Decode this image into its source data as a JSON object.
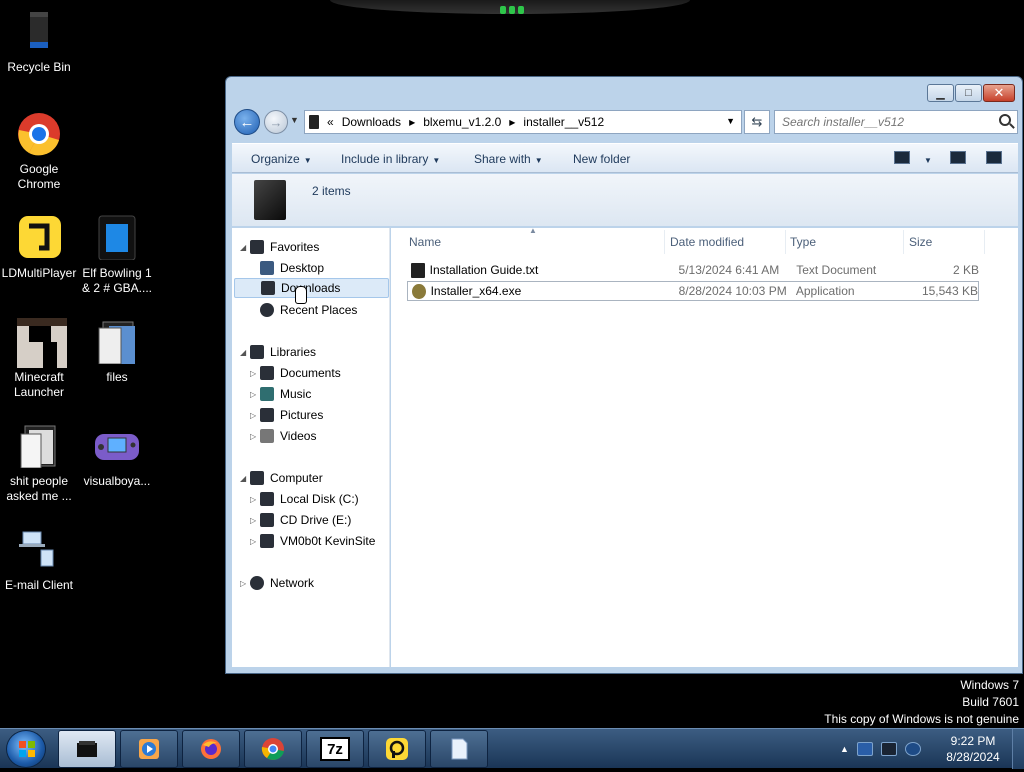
{
  "desktop_icons": [
    {
      "label": "Recycle Bin",
      "icon": "recycle-bin-icon"
    },
    {
      "label": "Google Chrome",
      "icon": "chrome-icon"
    },
    {
      "label": "LDMultiPlayer",
      "icon": "ldplayer-icon"
    },
    {
      "label": "Elf Bowling 1 & 2 # GBA....",
      "icon": "rom-file-icon"
    },
    {
      "label": "Minecraft Launcher",
      "icon": "minecraft-icon"
    },
    {
      "label": "files",
      "icon": "folder-icon"
    },
    {
      "label": "shit people asked me ...",
      "icon": "folder-icon"
    },
    {
      "label": "visualboya...",
      "icon": "gameboy-icon"
    },
    {
      "label": "E-mail Client",
      "icon": "email-client-icon"
    }
  ],
  "address_bar": {
    "prefix": "«",
    "crumbs": [
      "Downloads",
      "blxemu_v1.2.0",
      "installer__v512"
    ]
  },
  "search": {
    "placeholder": "Search installer__v512"
  },
  "toolbar": {
    "organize": "Organize",
    "include": "Include in library",
    "share": "Share with",
    "new_folder": "New folder"
  },
  "details": {
    "count": "2 items"
  },
  "nav": {
    "favorites": "Favorites",
    "desktop": "Desktop",
    "downloads": "Downloads",
    "recent": "Recent Places",
    "libraries": "Libraries",
    "documents": "Documents",
    "music": "Music",
    "pictures": "Pictures",
    "videos": "Videos",
    "computer": "Computer",
    "local_disk": "Local Disk (C:)",
    "cd_drive": "CD Drive (E:)",
    "vm_share": "VM0b0t KevinSite",
    "network": "Network"
  },
  "columns": {
    "name": "Name",
    "date": "Date modified",
    "type": "Type",
    "size": "Size"
  },
  "files": [
    {
      "name": "Installation Guide.txt",
      "date": "5/13/2024 6:41 AM",
      "type": "Text Document",
      "size": "2 KB"
    },
    {
      "name": "Installer_x64.exe",
      "date": "8/28/2024 10:03 PM",
      "type": "Application",
      "size": "15,543 KB"
    }
  ],
  "watermark": {
    "line1": "Windows 7",
    "line2": "Build 7601",
    "line3": "This copy of Windows is not genuine"
  },
  "taskbar": {
    "apps": [
      "explorer",
      "media-player",
      "firefox",
      "chrome",
      "7-zip",
      "ldplayer",
      "notepad"
    ],
    "seven_zip_label": "7z"
  },
  "clock": {
    "time": "9:22 PM",
    "date": "8/28/2024"
  },
  "colors": {
    "accent": "#1f5fb3",
    "selection": "#dceaf8",
    "taskbar": "#2a4668"
  }
}
